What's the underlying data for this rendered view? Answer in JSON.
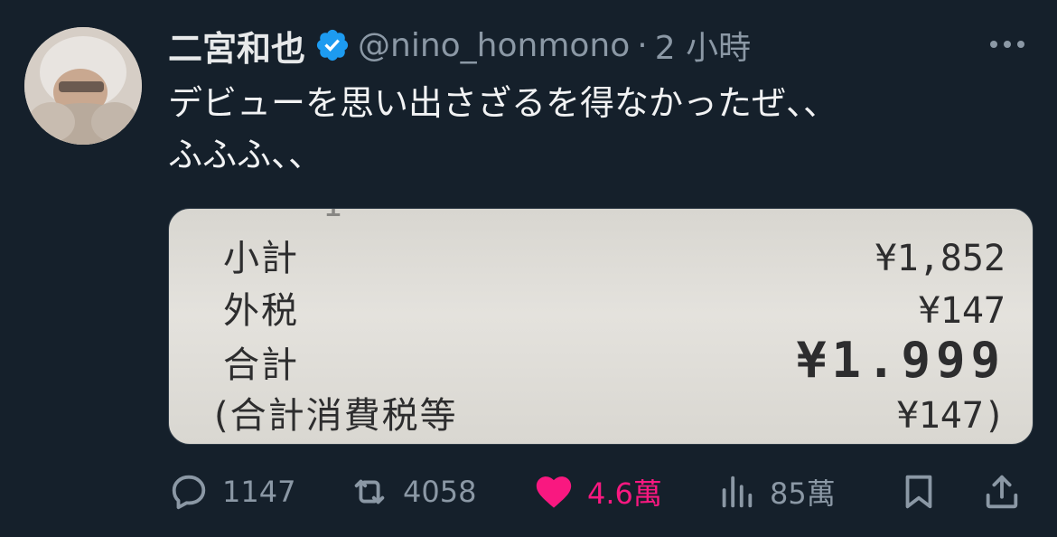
{
  "tweet": {
    "display_name": "二宮和也",
    "handle": "@nino_honmono",
    "separator": "·",
    "time": "2 小時",
    "text": "デビューを思い出さざるを得なかったぜ、、\nふふふ、、",
    "verified": true
  },
  "media": {
    "rows": [
      {
        "label": "小計",
        "value": "¥1,852"
      },
      {
        "label": "外税",
        "value": "¥147"
      },
      {
        "label": "合計",
        "value": "¥1.999"
      },
      {
        "label": "(合計消費税等",
        "value": "¥147)"
      }
    ]
  },
  "actions": {
    "reply_count": "1147",
    "retweet_count": "4058",
    "like_count": "4.6萬",
    "views_count": "85萬"
  },
  "colors": {
    "background": "#15202b",
    "secondary_text": "#8b98a5",
    "like_pink": "#f91880",
    "verified_blue": "#1d9bf0"
  }
}
